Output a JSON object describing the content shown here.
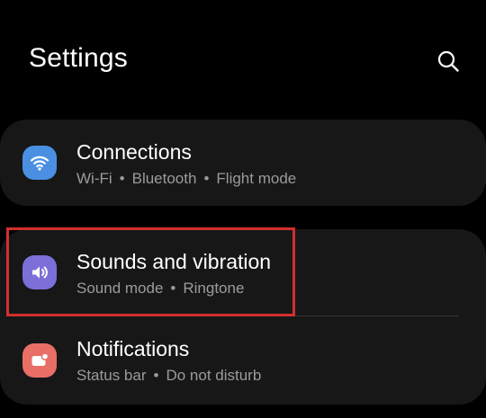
{
  "header": {
    "title": "Settings",
    "search_icon": "search-icon"
  },
  "settings": {
    "connections": {
      "title": "Connections",
      "subs": [
        "Wi-Fi",
        "Bluetooth",
        "Flight mode"
      ],
      "icon": "wifi-icon",
      "icon_color": "#4a8fe2"
    },
    "sounds": {
      "title": "Sounds and vibration",
      "subs": [
        "Sound mode",
        "Ringtone"
      ],
      "icon": "speaker-icon",
      "icon_color": "#7c6fd8"
    },
    "notifications": {
      "title": "Notifications",
      "subs": [
        "Status bar",
        "Do not disturb"
      ],
      "icon": "notification-icon",
      "icon_color": "#e96e66"
    }
  },
  "separator": "•",
  "highlight_color": "#d32f2f"
}
